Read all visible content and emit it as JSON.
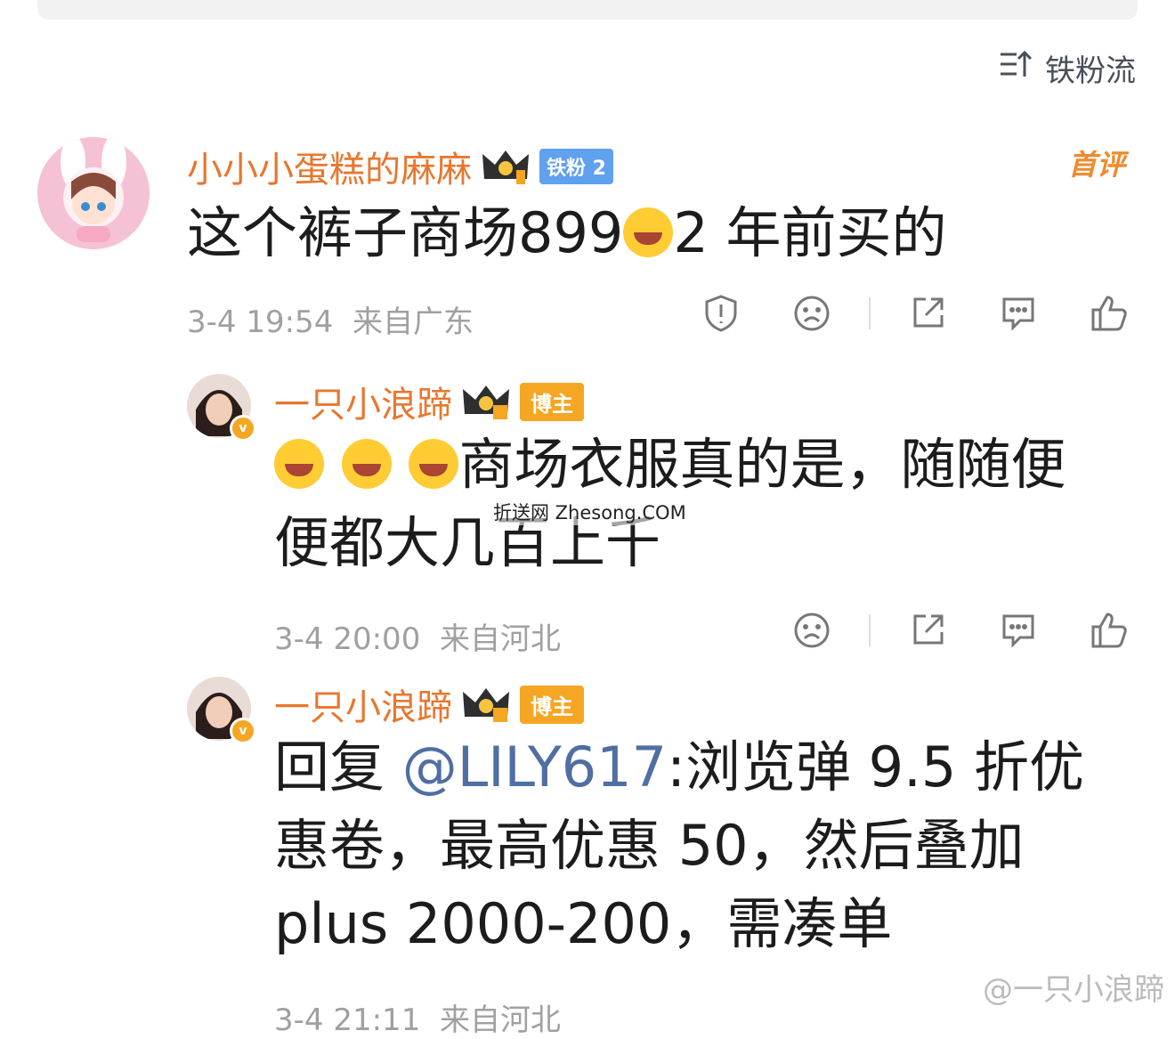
{
  "sort": {
    "label": "铁粉流"
  },
  "comments": [
    {
      "user": "小小小蛋糕的麻麻",
      "badge": "铁粉 2",
      "tag": "首评",
      "text": "这个裤子商场899",
      "text_after": "2 年前买的",
      "time": "3-4 19:54",
      "location": "来自广东"
    },
    {
      "user": "一只小浪蹄",
      "badge": "博主",
      "text": "商场衣服真的是，随随便便都大几百上千",
      "time": "3-4 20:00",
      "location": "来自河北"
    },
    {
      "user": "一只小浪蹄",
      "badge": "博主",
      "reply_prefix": "回复 ",
      "mention": "@LILY617",
      "text": ":浏览弹 9.5 折优惠卷，最高优惠 50，然后叠加 plus 2000-200，需凑单",
      "time": "3-4 21:11",
      "location": "来自河北"
    }
  ],
  "watermarks": {
    "site": "折送网 Zhesong.COM",
    "weibo": "@一只小浪蹄"
  },
  "icons": [
    "sort-icon",
    "report-icon",
    "dislike-icon",
    "share-icon",
    "comment-icon",
    "like-icon"
  ]
}
